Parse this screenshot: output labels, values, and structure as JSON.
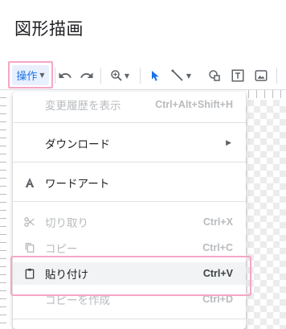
{
  "dialog": {
    "title": "図形描画"
  },
  "toolbar": {
    "actions_label": "操作",
    "icons": [
      "undo-icon",
      "redo-icon",
      "zoom-icon",
      "select-icon",
      "line-icon",
      "shape-icon",
      "textbox-icon",
      "image-icon"
    ]
  },
  "menu": {
    "items": [
      {
        "label": "変更履歴を表示",
        "shortcut": "Ctrl+Alt+Shift+H",
        "disabled": true
      },
      {
        "label": "ダウンロード",
        "submenu": true
      },
      {
        "label": "ワードアート",
        "icon": "wordart-icon"
      },
      {
        "label": "切り取り",
        "shortcut": "Ctrl+X",
        "disabled": true,
        "icon": "scissors-icon"
      },
      {
        "label": "コピー",
        "shortcut": "Ctrl+C",
        "disabled": true,
        "icon": "copy-icon"
      },
      {
        "label": "貼り付け",
        "shortcut": "Ctrl+V",
        "icon": "paste-icon"
      },
      {
        "label": "コピーを作成",
        "shortcut": "Ctrl+D",
        "disabled": true
      }
    ]
  },
  "colors": {
    "accent": "#1a73e8",
    "highlight": "#f4a6c6"
  }
}
